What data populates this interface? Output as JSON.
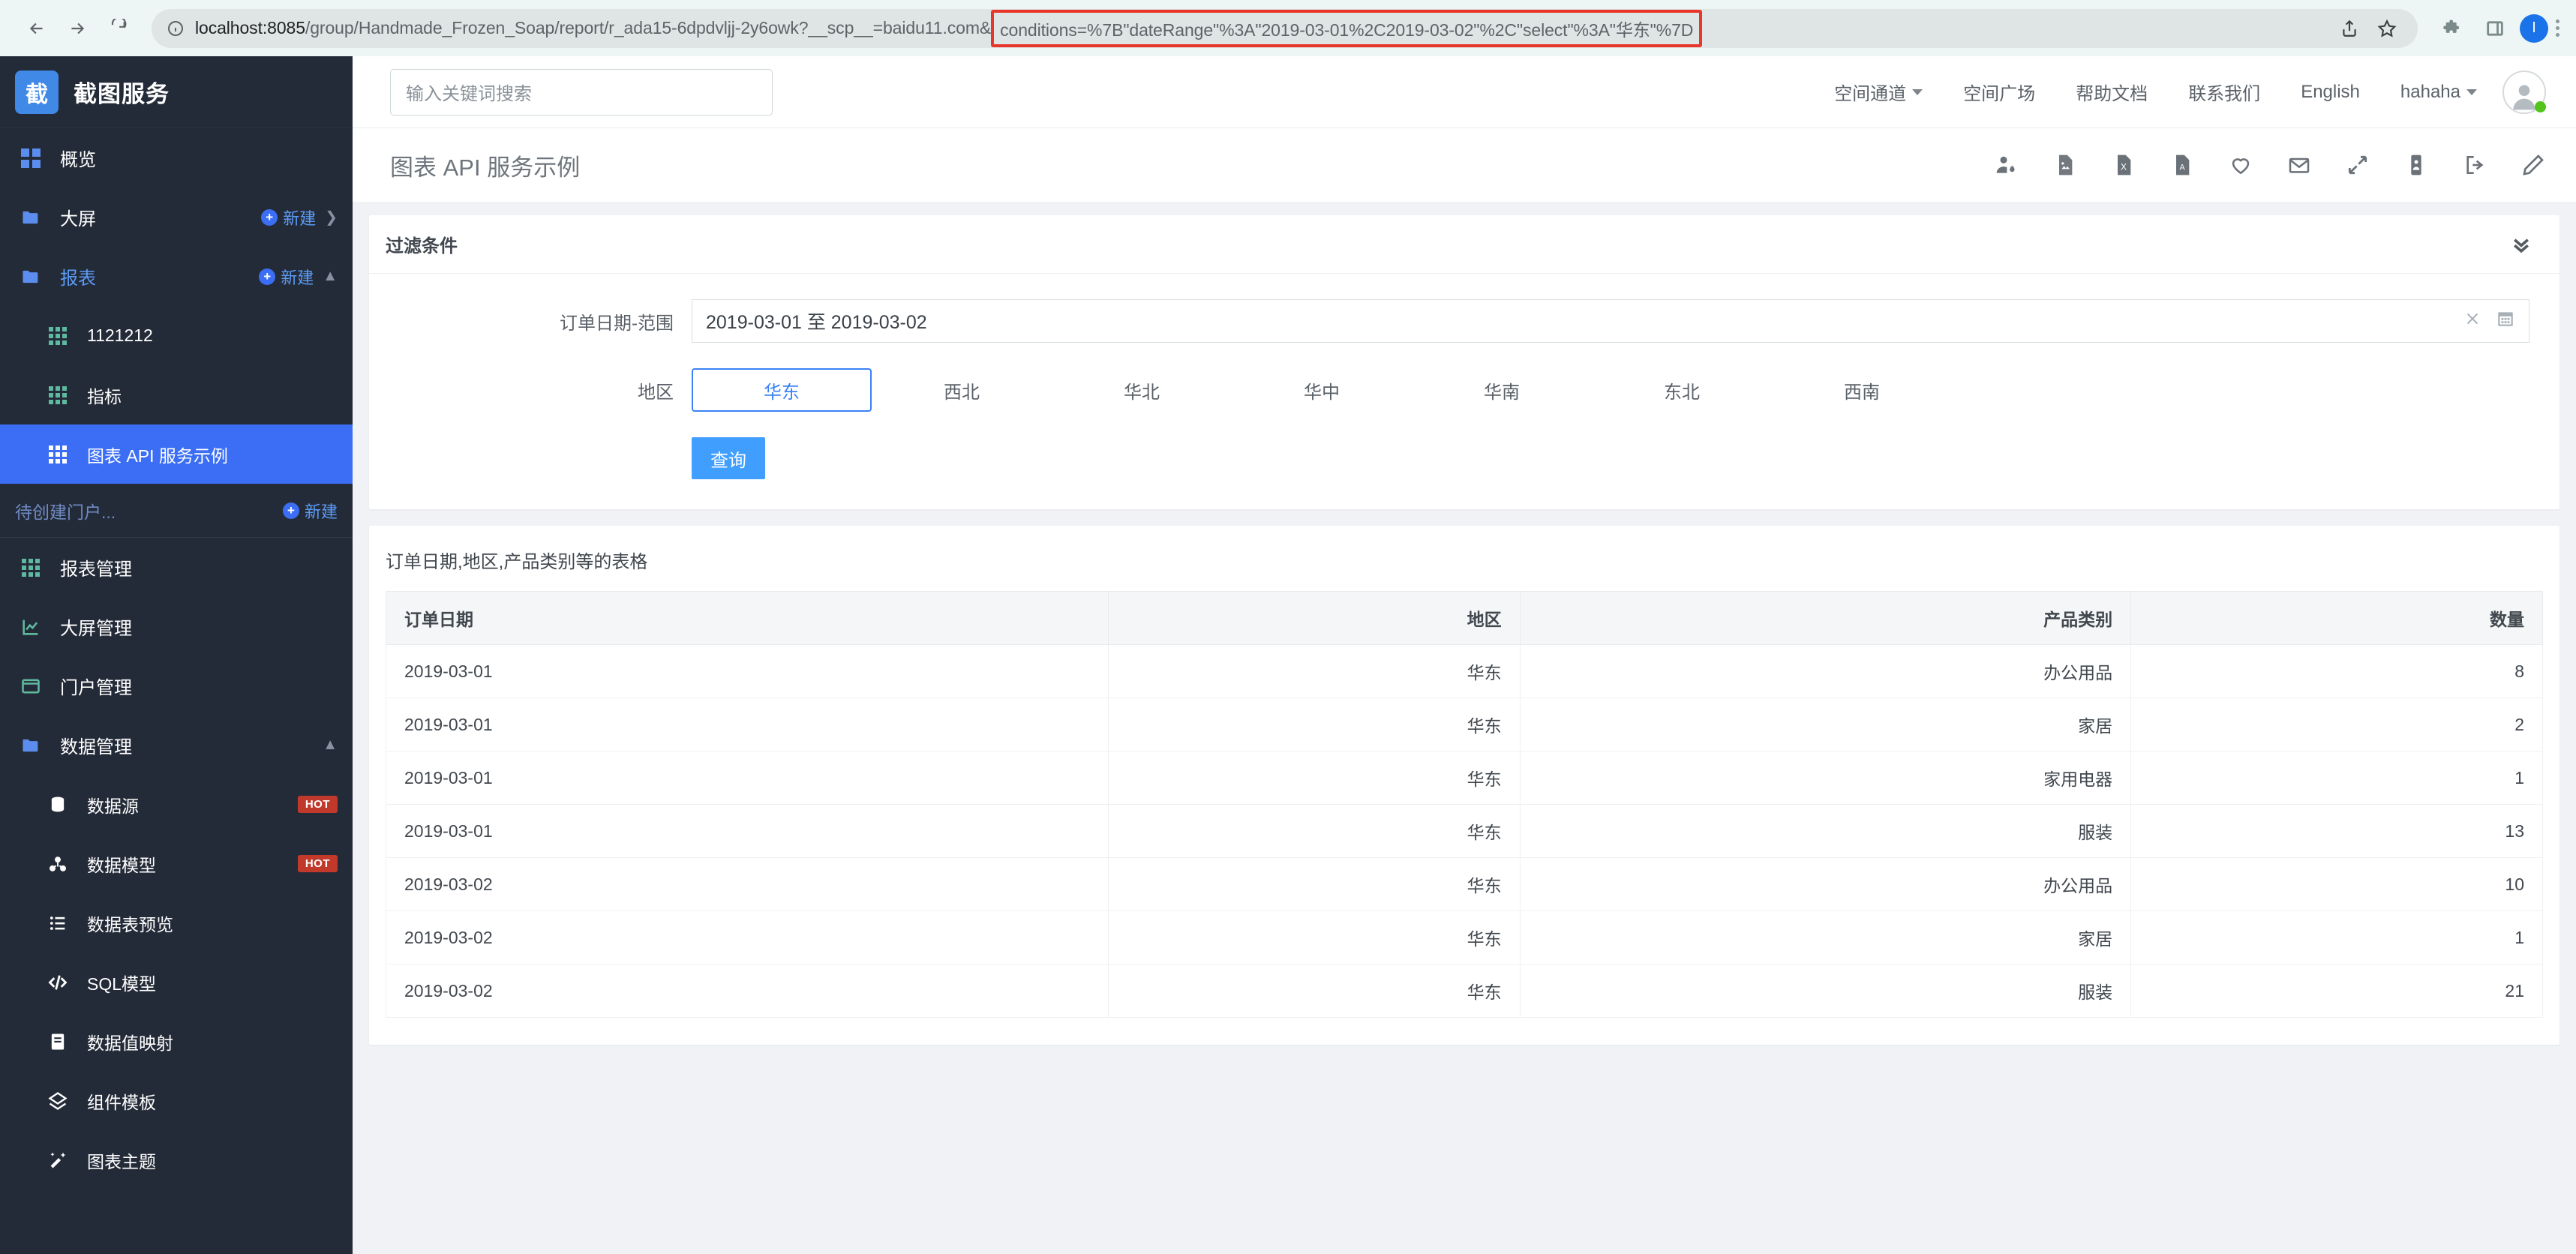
{
  "browser": {
    "url_domain": "localhost:8085",
    "url_path": "/group/Handmade_Frozen_Soap/report/r_ada15-6dpdvljj-2y6owk?__scp__=baidu11.com&",
    "url_highlighted": "conditions=%7B\"dateRange\"%3A\"2019-03-01%2C2019-03-02\"%2C\"select\"%3A\"华东\"%7D",
    "back_icon": "back-arrow-icon",
    "forward_icon": "forward-arrow-icon",
    "reload_icon": "reload-icon",
    "site_info_icon": "site-info-icon",
    "share_icon": "share-icon",
    "bookmark_icon": "bookmark-star-icon",
    "extensions_icon": "extensions-puzzle-icon",
    "sidepanel_icon": "side-panel-icon",
    "profile_initial": "I",
    "menu_icon": "kebab-menu-icon"
  },
  "sidebar": {
    "logo_text": "截",
    "title": "截图服务",
    "new_label": "新建",
    "items": [
      {
        "label": "概览",
        "icon": "dashboard-grid-icon",
        "type": "top"
      },
      {
        "label": "大屏",
        "icon": "folder-icon",
        "type": "folder",
        "has_new": true,
        "chevron": "right"
      },
      {
        "label": "报表",
        "icon": "folder-icon",
        "type": "folder",
        "has_new": true,
        "chevron": "up",
        "highlight": true
      }
    ],
    "report_children": [
      {
        "label": "1121212",
        "icon": "grid-icon"
      },
      {
        "label": "指标",
        "icon": "grid-icon"
      },
      {
        "label": "图表 API 服务示例",
        "icon": "grid-icon",
        "active": true
      }
    ],
    "pending_portal": {
      "label": "待创建门户...",
      "new_label": "新建"
    },
    "manage_items": [
      {
        "label": "报表管理",
        "icon": "grid-icon"
      },
      {
        "label": "大屏管理",
        "icon": "chart-line-icon"
      },
      {
        "label": "门户管理",
        "icon": "window-icon"
      },
      {
        "label": "数据管理",
        "icon": "folder-icon",
        "chevron": "up"
      }
    ],
    "data_children": [
      {
        "label": "数据源",
        "icon": "database-icon",
        "badge": "HOT"
      },
      {
        "label": "数据模型",
        "icon": "cube-model-icon",
        "badge": "HOT"
      },
      {
        "label": "数据表预览",
        "icon": "list-icon"
      },
      {
        "label": "SQL模型",
        "icon": "code-icon"
      },
      {
        "label": "数据值映射",
        "icon": "book-icon"
      },
      {
        "label": "组件模板",
        "icon": "component-icon"
      },
      {
        "label": "图表主题",
        "icon": "magic-wand-icon"
      }
    ]
  },
  "header": {
    "search_placeholder": "输入关键词搜索",
    "nav": [
      {
        "label": "空间通道",
        "has_caret": true
      },
      {
        "label": "空间广场",
        "has_caret": false
      },
      {
        "label": "帮助文档",
        "has_caret": false
      },
      {
        "label": "联系我们",
        "has_caret": false
      },
      {
        "label": "English",
        "has_caret": false
      },
      {
        "label": "hahaha",
        "has_caret": true
      }
    ],
    "avatar_icon": "user-avatar-icon"
  },
  "page": {
    "title": "图表 API 服务示例",
    "toolbar_icons": [
      "user-settings-icon",
      "export-image-icon",
      "export-excel-icon",
      "export-pdf-icon",
      "favorite-heart-icon",
      "email-icon",
      "fullscreen-icon",
      "mobile-preview-icon",
      "share-out-icon",
      "edit-pencil-icon"
    ]
  },
  "filter": {
    "title": "过滤条件",
    "collapse_icon": "double-chevron-down-icon",
    "date_label": "订单日期-范围",
    "date_value": "2019-03-01 至 2019-03-02",
    "clear_icon": "clear-x-icon",
    "calendar_icon": "calendar-icon",
    "region_label": "地区",
    "regions": [
      "华东",
      "西北",
      "华北",
      "华中",
      "华南",
      "东北",
      "西南"
    ],
    "selected_region": "华东",
    "query_button": "查询"
  },
  "table": {
    "title": "订单日期,地区,产品类别等的表格",
    "columns": [
      {
        "label": "订单日期",
        "align": "left"
      },
      {
        "label": "地区",
        "align": "right"
      },
      {
        "label": "产品类别",
        "align": "right"
      },
      {
        "label": "数量",
        "align": "right"
      }
    ],
    "rows": [
      [
        "2019-03-01",
        "华东",
        "办公用品",
        "8"
      ],
      [
        "2019-03-01",
        "华东",
        "家居",
        "2"
      ],
      [
        "2019-03-01",
        "华东",
        "家用电器",
        "1"
      ],
      [
        "2019-03-01",
        "华东",
        "服装",
        "13"
      ],
      [
        "2019-03-02",
        "华东",
        "办公用品",
        "10"
      ],
      [
        "2019-03-02",
        "华东",
        "家居",
        "1"
      ],
      [
        "2019-03-02",
        "华东",
        "服装",
        "21"
      ]
    ]
  },
  "colors": {
    "accent_blue": "#3b6ef5",
    "sidebar_bg": "#242b38",
    "primary_button": "#409eff",
    "hot_badge": "#c0392b",
    "url_highlight_border": "#e8362a"
  }
}
